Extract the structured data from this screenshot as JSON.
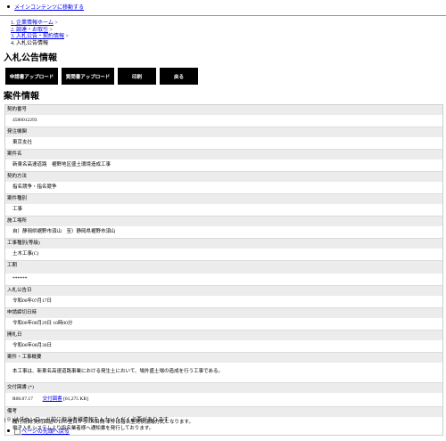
{
  "skip_link": "メインコンテンツに移動する",
  "breadcrumb": {
    "items": [
      "1. 企業情報ホーム",
      "2. 調達・お取引",
      "3. 入札公告・契約情報",
      "4. 入札公告情報"
    ],
    "separator": " >"
  },
  "page_title": "入札公告情報",
  "buttons": {
    "apply_upload": "申請書アップロード",
    "question_upload": "質問書アップロード",
    "print": "印刷",
    "back": "戻る"
  },
  "section_title": "案件情報",
  "fields": {
    "contract_no": {
      "label": "契約番号",
      "value": "4580012293"
    },
    "agency": {
      "label": "発注機関",
      "value": "東京支社"
    },
    "case_name": {
      "label": "案件名",
      "value": "新東名高速道路　裾野地区盛土環境造成工事"
    },
    "contract_method": {
      "label": "契約方法",
      "value": "指名競争・指名競争"
    },
    "case_type": {
      "label": "案件種別",
      "value": "工事"
    },
    "location": {
      "label": "施工場所",
      "value": "自）静岡県裾野市須山　至）静岡県裾野市須山"
    },
    "work_type": {
      "label": "工事種別(等級)",
      "value": "土木工事(C)"
    },
    "period": {
      "label": "工期",
      "value": "******"
    },
    "notice_date": {
      "label": "入札公告日",
      "value": "令和06年07月17日"
    },
    "deadline": {
      "label": "申請締切日時",
      "value": "令和06年08月29日 16時00分"
    },
    "opening": {
      "label": "開札日",
      "value": "令和06年08月30日"
    },
    "summary": {
      "label": "案件・工事概要",
      "value": "本工事は、新東名高速道路事業における発生土において、場外盛土場の造成を行う工事である。"
    },
    "docs": {
      "label": "交付図書 (*)",
      "date": "R06.07.17",
      "link": "交付図書",
      "size": "[61,275 KB]"
    },
    "remarks": {
      "label": "備考",
      "line1": "履行期間:契約締結の日の翌日から330日間 本件は指名型見積協議方式となります。",
      "line2": "電子入札システムより指名業者様へ通知書を発行しております。"
    }
  },
  "footnote": "(※)はダウンロード前に担当者様情報を入力いただく必要があります",
  "page_top_link": "ページの先頭へ戻る"
}
